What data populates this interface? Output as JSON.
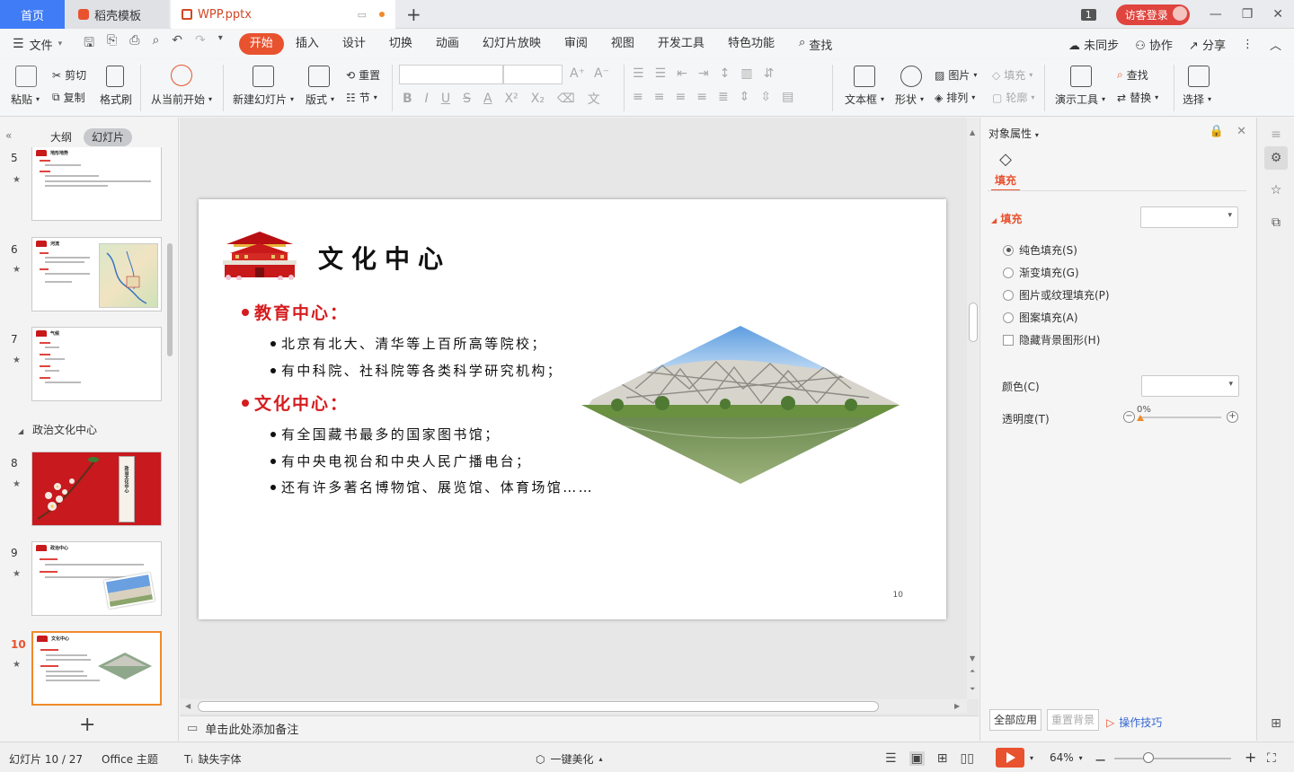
{
  "titlebar": {
    "home_tab": "首页",
    "template_tab": "稻壳模板",
    "doc_tab": "WPP.pptx",
    "new_tab": "+",
    "window_count": "1",
    "visitor": "访客登录"
  },
  "menubar": {
    "file": "文件",
    "tabs": [
      "开始",
      "插入",
      "设计",
      "切换",
      "动画",
      "幻灯片放映",
      "审阅",
      "视图",
      "开发工具",
      "特色功能"
    ],
    "active_tab": "开始",
    "search": "查找",
    "sync": "未同步",
    "collab": "协作",
    "share": "分享"
  },
  "ribbon": {
    "paste": "粘贴",
    "cut": "剪切",
    "copy": "复制",
    "format_painter": "格式刷",
    "from_current": "从当前开始",
    "new_slide": "新建幻灯片",
    "layout": "版式",
    "reset": "重置",
    "section": "节",
    "textbox": "文本框",
    "shapes": "形状",
    "picture": "图片",
    "fill": "填充",
    "arrange": "排列",
    "outline": "轮廓",
    "present_tools": "演示工具",
    "find": "查找",
    "replace": "替换",
    "select": "选择"
  },
  "left_pane": {
    "tab_outline": "大纲",
    "tab_slides": "幻灯片",
    "section_name": "政治文化中心",
    "slides": [
      {
        "num": "5",
        "title": "地形地势"
      },
      {
        "num": "6",
        "title": "河流"
      },
      {
        "num": "7",
        "title": "气候"
      },
      {
        "num": "8",
        "title": "政治文化中心"
      },
      {
        "num": "9",
        "title": "政治中心"
      },
      {
        "num": "10",
        "title": "文化中心"
      }
    ],
    "star": "★"
  },
  "slide": {
    "title": "文化中心",
    "heading1": "教育中心：",
    "items1": [
      "北京有北大、清华等上百所高等院校；",
      "有中科院、社科院等各类科学研究机构；"
    ],
    "heading2": "文化中心：",
    "items2": [
      "有全国藏书最多的国家图书馆；",
      "有中央电视台和中央人民广播电台；",
      "还有许多著名博物馆、展览馆、体育场馆……"
    ],
    "page_number": "10"
  },
  "notes": {
    "placeholder": "单击此处添加备注"
  },
  "right_panel": {
    "title": "对象属性",
    "fill_tab": "填充",
    "fill_section": "填充",
    "options": [
      "纯色填充(S)",
      "渐变填充(G)",
      "图片或纹理填充(P)",
      "图案填充(A)"
    ],
    "selected_option": "纯色填充(S)",
    "hide_bg": "隐藏背景图形(H)",
    "color_label": "颜色(C)",
    "transparency_label": "透明度(T)",
    "transparency_value": "0%",
    "apply_all": "全部应用",
    "reset_bg": "重置背景",
    "tips": "操作技巧"
  },
  "statusbar": {
    "slide_info": "幻灯片 10 / 27",
    "theme": "Office 主题",
    "missing_font": "缺失字体",
    "beautify": "一键美化",
    "zoom": "64%"
  },
  "colors": {
    "accent": "#e8522f",
    "home_tab": "#3f7cf6",
    "slide_red": "#d51c1f"
  }
}
